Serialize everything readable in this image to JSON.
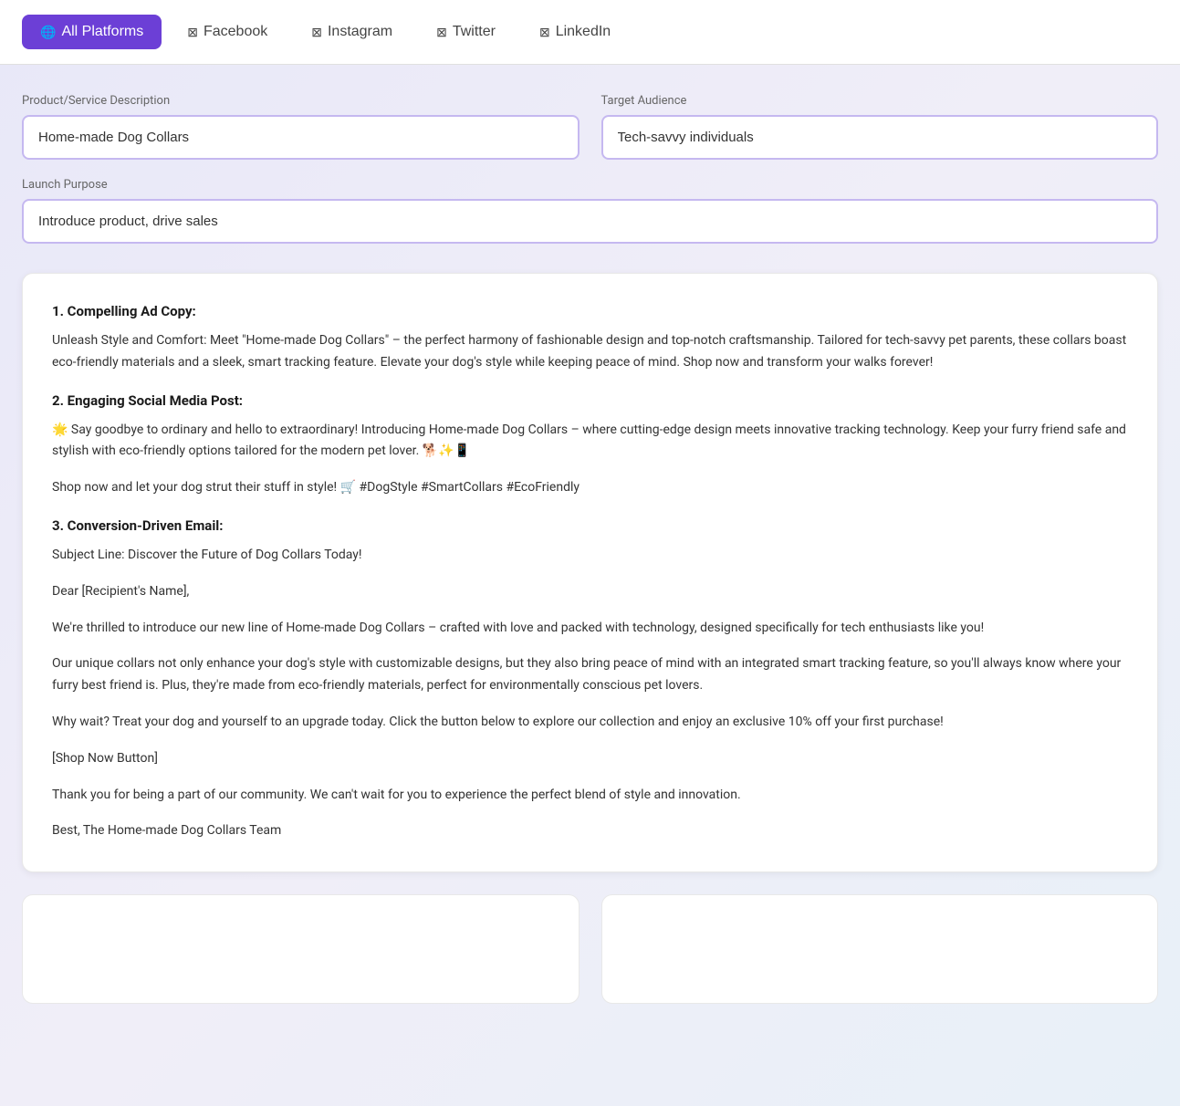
{
  "nav": {
    "tabs": [
      {
        "id": "all-platforms",
        "label": "All Platforms",
        "icon": "🌐",
        "active": true
      },
      {
        "id": "facebook",
        "label": "Facebook",
        "icon": "✖",
        "active": false
      },
      {
        "id": "instagram",
        "label": "Instagram",
        "icon": "✖",
        "active": false
      },
      {
        "id": "twitter",
        "label": "Twitter",
        "icon": "✖",
        "active": false
      },
      {
        "id": "linkedin",
        "label": "LinkedIn",
        "icon": "✖",
        "active": false
      }
    ]
  },
  "form": {
    "product_label": "Product/Service Description",
    "product_placeholder": "Home-made Dog Collars",
    "product_value": "Home-made Dog Collars",
    "target_label": "Target Audience",
    "target_placeholder": "Tech-savvy individuals",
    "target_value": "Tech-savvy individuals",
    "launch_label": "Launch Purpose",
    "launch_placeholder": "Introduce product, drive sales",
    "launch_value": "Introduce product, drive sales"
  },
  "results": {
    "section1_heading": "1. Compelling Ad Copy:",
    "section1_body": "Unleash Style and Comfort: Meet \"Home-made Dog Collars\" – the perfect harmony of fashionable design and top-notch craftsmanship. Tailored for tech-savvy pet parents, these collars boast eco-friendly materials and a sleek, smart tracking feature. Elevate your dog's style while keeping peace of mind. Shop now and transform your walks forever!",
    "section2_heading": "2. Engaging Social Media Post:",
    "section2_body1": "🌟 Say goodbye to ordinary and hello to extraordinary! Introducing Home-made Dog Collars – where cutting-edge design meets innovative tracking technology. Keep your furry friend safe and stylish with eco-friendly options tailored for the modern pet lover. 🐕✨📱",
    "section2_body2": "Shop now and let your dog strut their stuff in style! 🛒 #DogStyle #SmartCollars #EcoFriendly",
    "section3_heading": "3. Conversion-Driven Email:",
    "section3_subject": "Subject Line: Discover the Future of Dog Collars Today!",
    "section3_greeting": "Dear [Recipient's Name],",
    "section3_para1": "We're thrilled to introduce our new line of Home-made Dog Collars – crafted with love and packed with technology, designed specifically for tech enthusiasts like you!",
    "section3_para2": "Our unique collars not only enhance your dog's style with customizable designs, but they also bring peace of mind with an integrated smart tracking feature, so you'll always know where your furry best friend is. Plus, they're made from eco-friendly materials, perfect for environmentally conscious pet lovers.",
    "section3_para3": "Why wait? Treat your dog and yourself to an upgrade today. Click the button below to explore our collection and enjoy an exclusive 10% off your first purchase!",
    "section3_button_placeholder": "[Shop Now Button]",
    "section3_closing1": "Thank you for being a part of our community. We can't wait for you to experience the perfect blend of style and innovation.",
    "section3_closing2": "Best, The Home-made Dog Collars Team"
  },
  "colors": {
    "accent": "#6c3fd6",
    "active_tab_bg": "#6c3fd6",
    "input_border": "#c5b8f0"
  }
}
